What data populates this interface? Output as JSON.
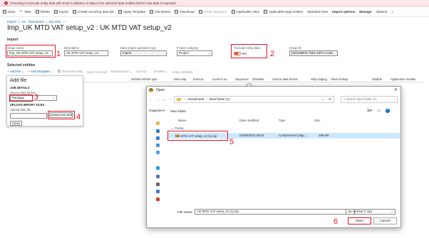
{
  "warning": "Choosing to truncate entity data will result in deletion of data in the selected data entities before new data is imported.",
  "action_pane": [
    {
      "label": "Save",
      "icon": "save-icon",
      "dim": false
    },
    {
      "label": "New",
      "icon": "plus-icon",
      "dim": false
    },
    {
      "label": "Delete",
      "icon": "delete-icon",
      "dim": false
    },
    {
      "label": "Import",
      "icon": "import-icon",
      "dim": false
    },
    {
      "label": "Create recurring data job",
      "icon": "recurring-icon",
      "dim": false
    },
    {
      "label": "Apply Template",
      "icon": "template-icon",
      "dim": false
    },
    {
      "label": "Job history",
      "icon": "history-icon",
      "dim": false
    },
    {
      "label": "Download",
      "icon": "download-icon",
      "dim": false
    },
    {
      "label": "Entity sequence",
      "icon": "sequence-icon",
      "dim": true
    },
    {
      "label": "Applicable roles",
      "icon": "roles-icon",
      "dim": false
    },
    {
      "label": "Applicable legal entities",
      "icon": "legal-entity-icon",
      "dim": false
    },
    {
      "label": "Standard view",
      "icon": "",
      "dim": false
    },
    {
      "label": "Import options",
      "icon": "",
      "dim": false,
      "bold": true
    },
    {
      "label": "Manage",
      "icon": "",
      "dim": false,
      "bold": true
    },
    {
      "label": "Options",
      "icon": "",
      "dim": false
    },
    {
      "label": "",
      "icon": "search-icon",
      "dim": false
    }
  ],
  "breadcrumb": [
    "Import",
    "AX : Operations",
    "My view"
  ],
  "page_title": "Imp_UK MTD VAT setup_v2 : UK MTD VAT setup_v2",
  "import_section": {
    "header": "Import",
    "group_name": {
      "label": "Group name",
      "value": "Imp_UK MTD VAT setup_v2"
    },
    "description": {
      "label": "Description",
      "value": "UK MTD VAT setup_v2"
    },
    "operation_type": {
      "label": "Data project operation type",
      "value": "Import"
    },
    "project_category": {
      "label": "Project category",
      "value": "Project"
    },
    "truncate": {
      "label": "Truncate entity data",
      "value": "Yes"
    },
    "group_id": {
      "label": "Group ID",
      "value": "{0D425BF6-7591-4EF4-A12E..."
    }
  },
  "markers": {
    "m1": "1",
    "m2": "2",
    "m3": "3",
    "m4": "4",
    "m5": "5",
    "m6": "6"
  },
  "entities": {
    "header": "Selected entities",
    "toolbar": [
      "Add file",
      "Add template",
      "Remove entity",
      "Open in Excel",
      "Resequence",
      "Sort by",
      "Disable",
      "Entity attribute"
    ],
    "columns": [
      "Default refresh type",
      "View map",
      "Executi...",
      "Level in se...",
      "Sequence",
      "Obsolete",
      "Source data format",
      "Skip staging",
      "Sheet lookup",
      "Disable",
      "Application module"
    ]
  },
  "add_file": {
    "title": "Add file",
    "job_details": "JOB DETAILS",
    "source_format_label": "Source data format",
    "source_format_value": "Package",
    "upload_header": "UPLOAD IMPORT FILES",
    "upload_label": "Upload data file",
    "upload_button": "Upload and add",
    "close_button": "Close"
  },
  "open_dialog": {
    "title": "Open",
    "address": [
      "Downloads",
      "New folder (1)"
    ],
    "search_placeholder": "Search New folder (1)",
    "organize": "Organize",
    "new_folder": "New folder",
    "columns": [
      "Name",
      "Date modified",
      "Type",
      "Size"
    ],
    "group": "Today",
    "file": {
      "name": "UK MTD VAT setup_v2 (1).zip",
      "date": "02/08/2023 08:03",
      "type": "Compressed (zipp...",
      "size": "196 KB"
    },
    "filename_label": "File name:",
    "filename_value": "UK MTD VAT setup_v2 (1).zip",
    "filetype_value": "zip Archive (*.zip)",
    "open_button": "Open",
    "cancel_button": "Cancel"
  }
}
